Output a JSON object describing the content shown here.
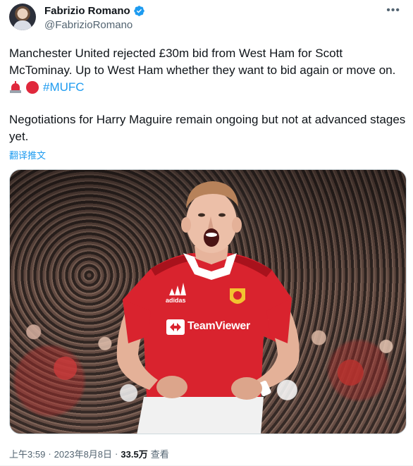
{
  "author": {
    "name": "Fabrizio Romano",
    "handle": "@FabrizioRomano",
    "verified": true
  },
  "tweet": {
    "paragraph1": "Manchester United rejected £30m bid from West Ham for Scott McTominay. Up to West Ham whether they want to bid again or move on.",
    "emojis": [
      "police-light-icon",
      "red-circle-icon"
    ],
    "hashtag": "#MUFC",
    "paragraph2": "Negotiations for Harry Maguire remain ongoing but not at advanced stages yet.",
    "translate_label": "翻译推文"
  },
  "media": {
    "jersey_sponsor": "TeamViewer",
    "jersey_brand": "adidas"
  },
  "meta": {
    "time": "上午3:59",
    "date": "2023年8月8日",
    "separator": "·",
    "views_count": "33.5万",
    "views_label": "查看"
  },
  "colors": {
    "accent": "#1d9bf0",
    "secondary_text": "#536471",
    "primary_text": "#0f1419",
    "jersey_red": "#d9232e"
  }
}
